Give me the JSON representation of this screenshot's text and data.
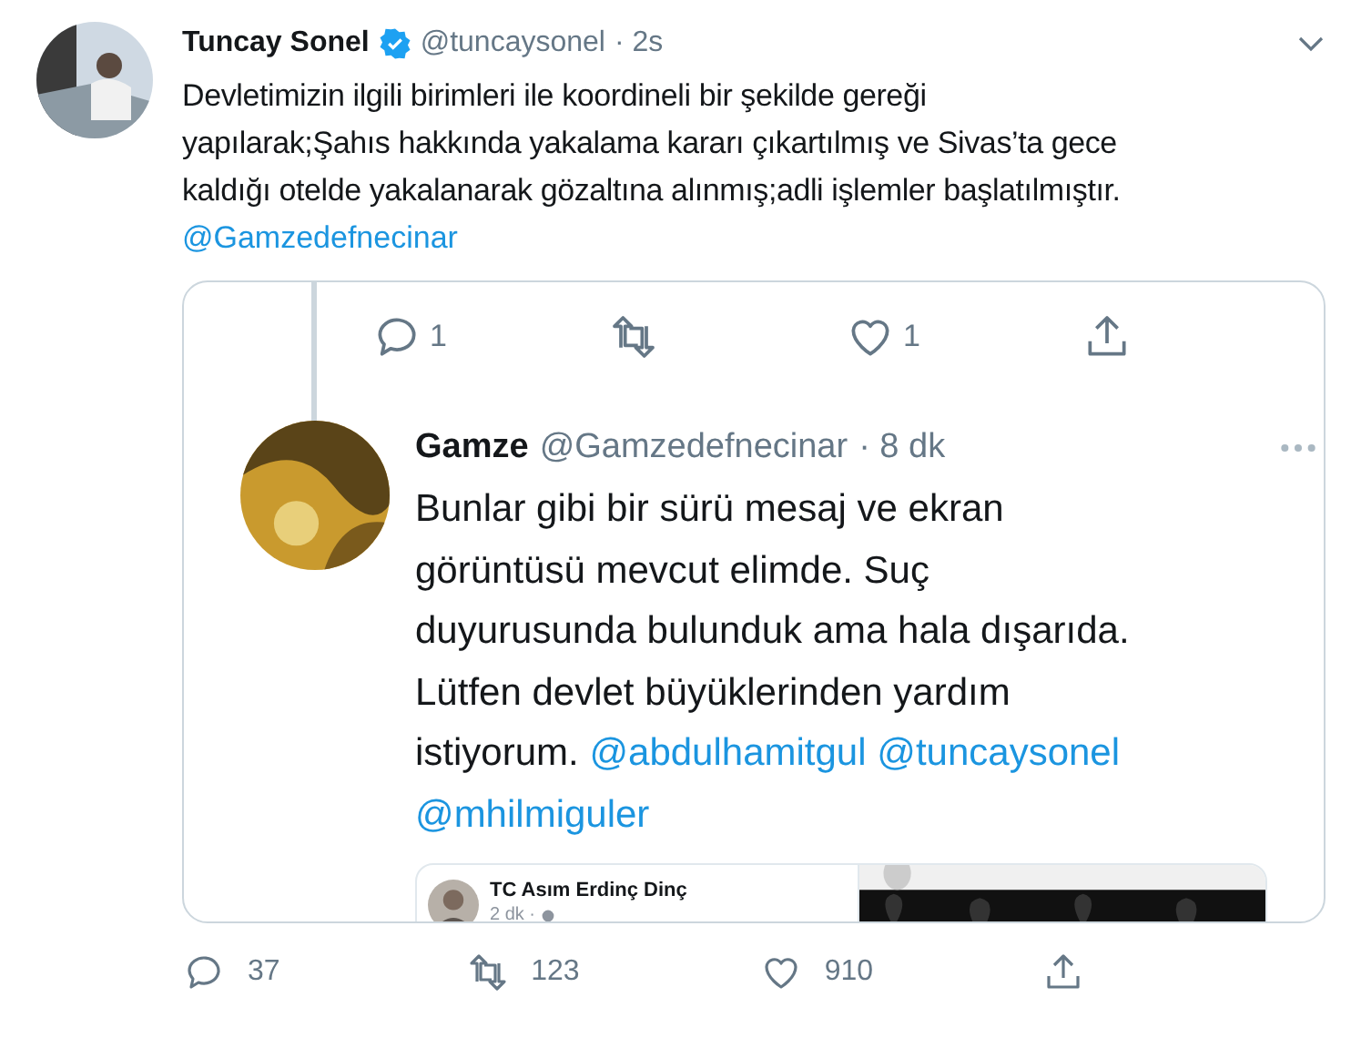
{
  "tweet": {
    "author": {
      "name": "Tuncay Sonel",
      "verified": true,
      "handle": "@tuncaysonel",
      "time": "· 2s"
    },
    "text_lines": [
      "Devletimizin ilgili birimleri ile koordineli bir şekilde gereği",
      "yapılarak;Şahıs hakkında yakalama kararı çıkartılmış ve Sivas’ta gece",
      "kaldığı otelde yakalanarak gözaltına alınmış;adli işlemler başlatılmıştır."
    ],
    "mention": "@Gamzedefnecinar",
    "screenshot": {
      "thread_actions": [
        {
          "kind": "reply",
          "count": "1"
        },
        {
          "kind": "retweet"
        },
        {
          "kind": "like",
          "count": "1"
        },
        {
          "kind": "share"
        }
      ],
      "reply": {
        "name": "Gamze",
        "handle": "@Gamzedefnecinar",
        "time": "· 8 dk",
        "lines": [
          [
            {
              "kind": "plain",
              "text": "Bunlar gibi bir sürü mesaj ve ekran"
            }
          ],
          [
            {
              "kind": "plain",
              "text": "görüntüsü mevcut elimde. Suç"
            }
          ],
          [
            {
              "kind": "plain",
              "text": "duyurusunda bulunduk ama hala dışarıda."
            }
          ],
          [
            {
              "kind": "plain",
              "text": "Lütfen devlet büyüklerinden yardım"
            }
          ],
          [
            {
              "kind": "plain",
              "text": "istiyorum."
            },
            {
              "kind": "mention",
              "text": "@abdulhamitgul"
            },
            {
              "kind": "mention",
              "text": "@tuncaysonel"
            }
          ],
          [
            {
              "kind": "mention",
              "text": "@mhilmiguler"
            }
          ]
        ]
      },
      "post": {
        "name": "TC Asım Erdinç Dinç",
        "time": "2 dk ·"
      }
    },
    "actions": [
      {
        "kind": "reply",
        "count": "37"
      },
      {
        "kind": "retweet",
        "count": "123"
      },
      {
        "kind": "like",
        "count": "910"
      },
      {
        "kind": "share"
      }
    ]
  }
}
